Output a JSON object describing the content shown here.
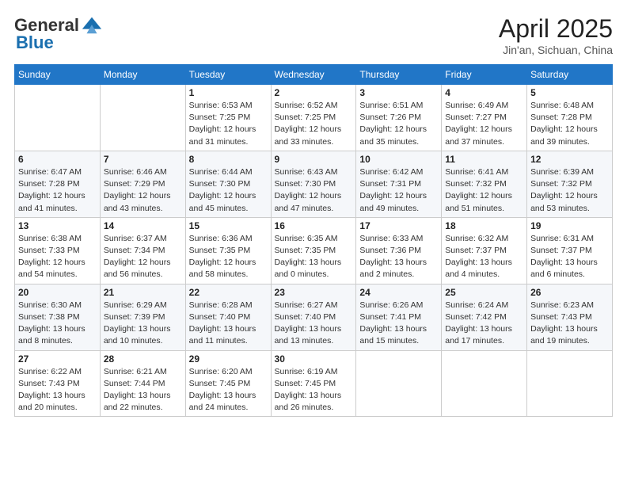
{
  "logo": {
    "general": "General",
    "blue": "Blue"
  },
  "header": {
    "month_year": "April 2025",
    "location": "Jin'an, Sichuan, China"
  },
  "days_of_week": [
    "Sunday",
    "Monday",
    "Tuesday",
    "Wednesday",
    "Thursday",
    "Friday",
    "Saturday"
  ],
  "weeks": [
    [
      {
        "day": "",
        "info": ""
      },
      {
        "day": "",
        "info": ""
      },
      {
        "day": "1",
        "info": "Sunrise: 6:53 AM\nSunset: 7:25 PM\nDaylight: 12 hours\nand 31 minutes."
      },
      {
        "day": "2",
        "info": "Sunrise: 6:52 AM\nSunset: 7:25 PM\nDaylight: 12 hours\nand 33 minutes."
      },
      {
        "day": "3",
        "info": "Sunrise: 6:51 AM\nSunset: 7:26 PM\nDaylight: 12 hours\nand 35 minutes."
      },
      {
        "day": "4",
        "info": "Sunrise: 6:49 AM\nSunset: 7:27 PM\nDaylight: 12 hours\nand 37 minutes."
      },
      {
        "day": "5",
        "info": "Sunrise: 6:48 AM\nSunset: 7:28 PM\nDaylight: 12 hours\nand 39 minutes."
      }
    ],
    [
      {
        "day": "6",
        "info": "Sunrise: 6:47 AM\nSunset: 7:28 PM\nDaylight: 12 hours\nand 41 minutes."
      },
      {
        "day": "7",
        "info": "Sunrise: 6:46 AM\nSunset: 7:29 PM\nDaylight: 12 hours\nand 43 minutes."
      },
      {
        "day": "8",
        "info": "Sunrise: 6:44 AM\nSunset: 7:30 PM\nDaylight: 12 hours\nand 45 minutes."
      },
      {
        "day": "9",
        "info": "Sunrise: 6:43 AM\nSunset: 7:30 PM\nDaylight: 12 hours\nand 47 minutes."
      },
      {
        "day": "10",
        "info": "Sunrise: 6:42 AM\nSunset: 7:31 PM\nDaylight: 12 hours\nand 49 minutes."
      },
      {
        "day": "11",
        "info": "Sunrise: 6:41 AM\nSunset: 7:32 PM\nDaylight: 12 hours\nand 51 minutes."
      },
      {
        "day": "12",
        "info": "Sunrise: 6:39 AM\nSunset: 7:32 PM\nDaylight: 12 hours\nand 53 minutes."
      }
    ],
    [
      {
        "day": "13",
        "info": "Sunrise: 6:38 AM\nSunset: 7:33 PM\nDaylight: 12 hours\nand 54 minutes."
      },
      {
        "day": "14",
        "info": "Sunrise: 6:37 AM\nSunset: 7:34 PM\nDaylight: 12 hours\nand 56 minutes."
      },
      {
        "day": "15",
        "info": "Sunrise: 6:36 AM\nSunset: 7:35 PM\nDaylight: 12 hours\nand 58 minutes."
      },
      {
        "day": "16",
        "info": "Sunrise: 6:35 AM\nSunset: 7:35 PM\nDaylight: 13 hours\nand 0 minutes."
      },
      {
        "day": "17",
        "info": "Sunrise: 6:33 AM\nSunset: 7:36 PM\nDaylight: 13 hours\nand 2 minutes."
      },
      {
        "day": "18",
        "info": "Sunrise: 6:32 AM\nSunset: 7:37 PM\nDaylight: 13 hours\nand 4 minutes."
      },
      {
        "day": "19",
        "info": "Sunrise: 6:31 AM\nSunset: 7:37 PM\nDaylight: 13 hours\nand 6 minutes."
      }
    ],
    [
      {
        "day": "20",
        "info": "Sunrise: 6:30 AM\nSunset: 7:38 PM\nDaylight: 13 hours\nand 8 minutes."
      },
      {
        "day": "21",
        "info": "Sunrise: 6:29 AM\nSunset: 7:39 PM\nDaylight: 13 hours\nand 10 minutes."
      },
      {
        "day": "22",
        "info": "Sunrise: 6:28 AM\nSunset: 7:40 PM\nDaylight: 13 hours\nand 11 minutes."
      },
      {
        "day": "23",
        "info": "Sunrise: 6:27 AM\nSunset: 7:40 PM\nDaylight: 13 hours\nand 13 minutes."
      },
      {
        "day": "24",
        "info": "Sunrise: 6:26 AM\nSunset: 7:41 PM\nDaylight: 13 hours\nand 15 minutes."
      },
      {
        "day": "25",
        "info": "Sunrise: 6:24 AM\nSunset: 7:42 PM\nDaylight: 13 hours\nand 17 minutes."
      },
      {
        "day": "26",
        "info": "Sunrise: 6:23 AM\nSunset: 7:43 PM\nDaylight: 13 hours\nand 19 minutes."
      }
    ],
    [
      {
        "day": "27",
        "info": "Sunrise: 6:22 AM\nSunset: 7:43 PM\nDaylight: 13 hours\nand 20 minutes."
      },
      {
        "day": "28",
        "info": "Sunrise: 6:21 AM\nSunset: 7:44 PM\nDaylight: 13 hours\nand 22 minutes."
      },
      {
        "day": "29",
        "info": "Sunrise: 6:20 AM\nSunset: 7:45 PM\nDaylight: 13 hours\nand 24 minutes."
      },
      {
        "day": "30",
        "info": "Sunrise: 6:19 AM\nSunset: 7:45 PM\nDaylight: 13 hours\nand 26 minutes."
      },
      {
        "day": "",
        "info": ""
      },
      {
        "day": "",
        "info": ""
      },
      {
        "day": "",
        "info": ""
      }
    ]
  ]
}
